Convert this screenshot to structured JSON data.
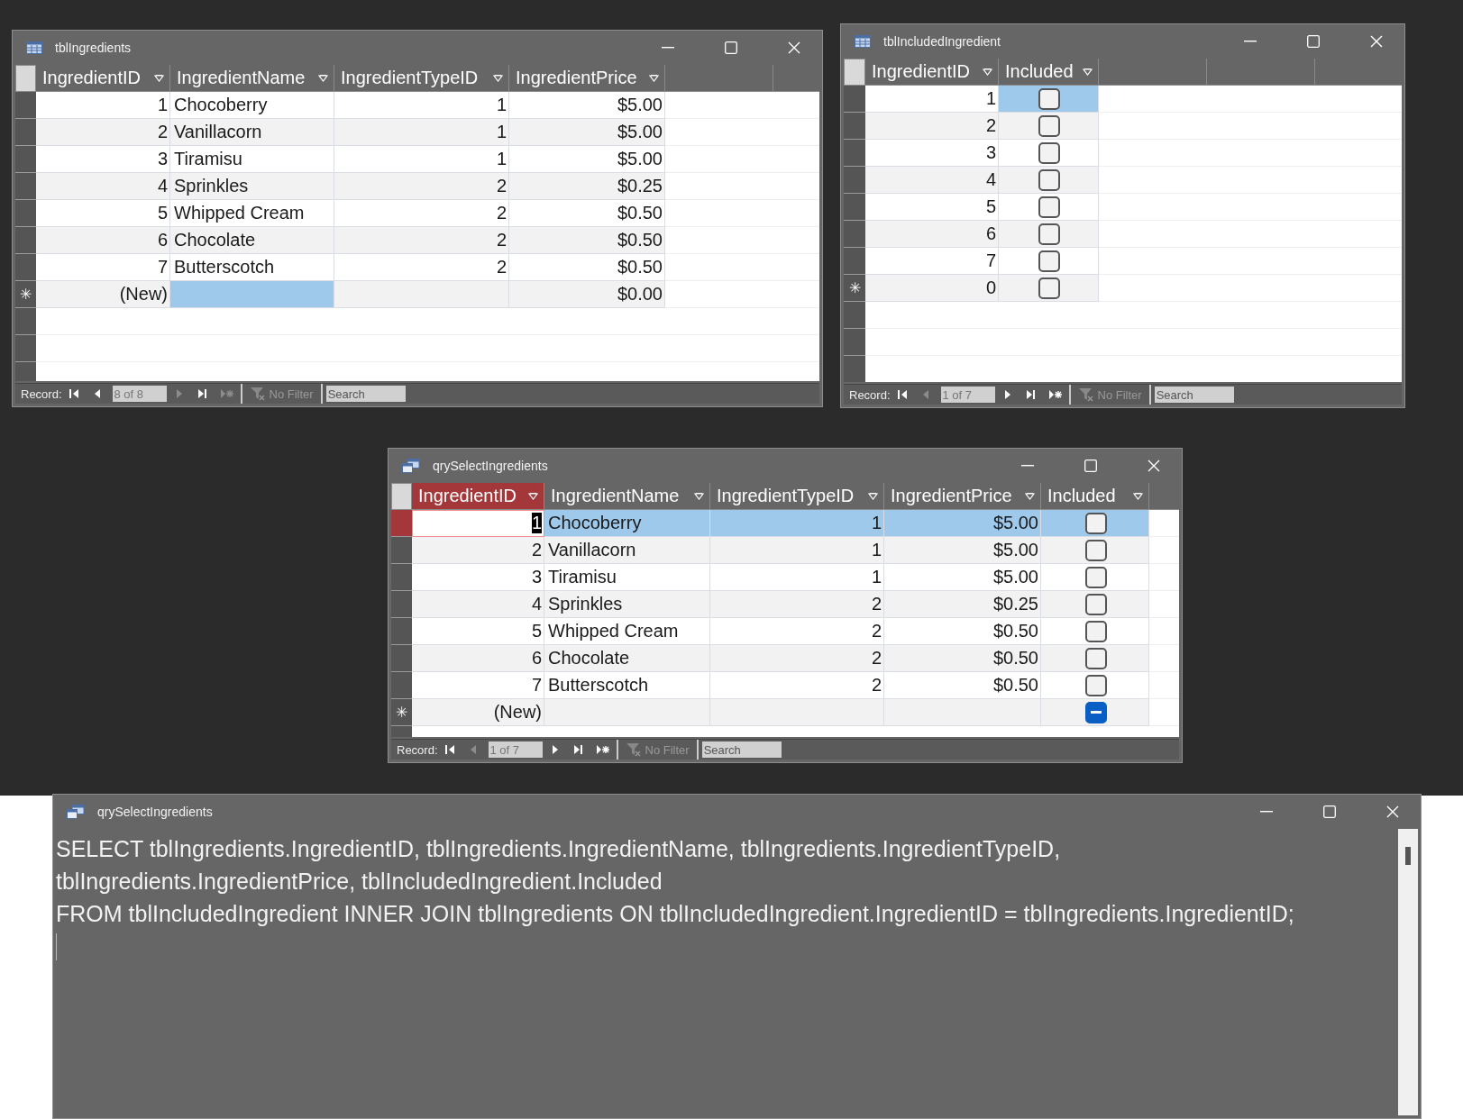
{
  "windows": [
    {
      "kind": "table",
      "title": "tblIngredients",
      "columns": [
        {
          "label": "IngredientID",
          "kind": "number",
          "focused": false
        },
        {
          "label": "IngredientName",
          "kind": "text",
          "focused": false
        },
        {
          "label": "IngredientTypeID",
          "kind": "number",
          "focused": false
        },
        {
          "label": "IngredientPrice",
          "kind": "number",
          "focused": false
        }
      ],
      "rows": [
        {
          "current": false,
          "cells": [
            {
              "text": "1",
              "selected": false
            },
            {
              "text": "Chocoberry",
              "selected": false
            },
            {
              "text": "1",
              "selected": false
            },
            {
              "text": "$5.00",
              "selected": false
            }
          ]
        },
        {
          "current": false,
          "cells": [
            {
              "text": "2",
              "selected": false
            },
            {
              "text": "Vanillacorn",
              "selected": false
            },
            {
              "text": "1",
              "selected": false
            },
            {
              "text": "$5.00",
              "selected": false
            }
          ]
        },
        {
          "current": false,
          "cells": [
            {
              "text": "3",
              "selected": false
            },
            {
              "text": "Tiramisu",
              "selected": false
            },
            {
              "text": "1",
              "selected": false
            },
            {
              "text": "$5.00",
              "selected": false
            }
          ]
        },
        {
          "current": false,
          "cells": [
            {
              "text": "4",
              "selected": false
            },
            {
              "text": "Sprinkles",
              "selected": false
            },
            {
              "text": "2",
              "selected": false
            },
            {
              "text": "$0.25",
              "selected": false
            }
          ]
        },
        {
          "current": false,
          "cells": [
            {
              "text": "5",
              "selected": false
            },
            {
              "text": "Whipped Cream",
              "selected": false
            },
            {
              "text": "2",
              "selected": false
            },
            {
              "text": "$0.50",
              "selected": false
            }
          ]
        },
        {
          "current": false,
          "cells": [
            {
              "text": "6",
              "selected": false
            },
            {
              "text": "Chocolate",
              "selected": false
            },
            {
              "text": "2",
              "selected": false
            },
            {
              "text": "$0.50",
              "selected": false
            }
          ]
        },
        {
          "current": false,
          "cells": [
            {
              "text": "7",
              "selected": false
            },
            {
              "text": "Butterscotch",
              "selected": false
            },
            {
              "text": "2",
              "selected": false
            },
            {
              "text": "$0.50",
              "selected": false
            }
          ]
        },
        {
          "current": false,
          "selector_text": "✳",
          "cells": [
            {
              "text": "(New)",
              "selected": false
            },
            {
              "selected": true
            },
            {
              "selected": false
            },
            {
              "text": "$0.00",
              "selected": false
            }
          ]
        }
      ],
      "status": {
        "label": "Record:",
        "nav": [
          {
            "kind": "first",
            "disabled": false
          },
          {
            "kind": "previous",
            "disabled": false
          },
          {
            "kind": "next",
            "disabled": true
          },
          {
            "kind": "last",
            "disabled": false
          },
          {
            "kind": "new",
            "disabled": true
          }
        ],
        "position": "8 of 8",
        "filter": "No Filter",
        "search_placeholder": "Search"
      }
    },
    {
      "kind": "table",
      "title": "tblIncludedIngredient",
      "columns": [
        {
          "label": "IngredientID",
          "kind": "number",
          "focused": false
        },
        {
          "label": "Included",
          "kind": "checkbox",
          "focused": false
        }
      ],
      "rows": [
        {
          "current": false,
          "cells": [
            {
              "text": "1",
              "selected": false
            },
            {
              "checked": false,
              "indeterminate": false,
              "selected": true
            }
          ]
        },
        {
          "current": false,
          "cells": [
            {
              "text": "2",
              "selected": false
            },
            {
              "checked": false,
              "indeterminate": false,
              "selected": false
            }
          ]
        },
        {
          "current": false,
          "cells": [
            {
              "text": "3",
              "selected": false
            },
            {
              "checked": false,
              "indeterminate": false,
              "selected": false
            }
          ]
        },
        {
          "current": false,
          "cells": [
            {
              "text": "4",
              "selected": false
            },
            {
              "checked": false,
              "indeterminate": false,
              "selected": false
            }
          ]
        },
        {
          "current": false,
          "cells": [
            {
              "text": "5",
              "selected": false
            },
            {
              "checked": false,
              "indeterminate": false,
              "selected": false
            }
          ]
        },
        {
          "current": false,
          "cells": [
            {
              "text": "6",
              "selected": false
            },
            {
              "checked": false,
              "indeterminate": false,
              "selected": false
            }
          ]
        },
        {
          "current": false,
          "cells": [
            {
              "text": "7",
              "selected": false
            },
            {
              "checked": false,
              "indeterminate": false,
              "selected": false
            }
          ]
        },
        {
          "current": false,
          "selector_text": "✳",
          "cells": [
            {
              "text": "0",
              "selected": false
            },
            {
              "checked": false,
              "indeterminate": false,
              "selected": false
            }
          ]
        }
      ],
      "status": {
        "label": "Record:",
        "nav": [
          {
            "kind": "first",
            "disabled": false
          },
          {
            "kind": "previous",
            "disabled": true
          },
          {
            "kind": "next",
            "disabled": false
          },
          {
            "kind": "last",
            "disabled": false
          },
          {
            "kind": "new",
            "disabled": false
          }
        ],
        "position": "1 of 7",
        "filter": "No Filter",
        "search_placeholder": "Search"
      }
    },
    {
      "kind": "query",
      "title": "qrySelectIngredients",
      "columns": [
        {
          "label": "IngredientID",
          "kind": "number",
          "focused": true
        },
        {
          "label": "IngredientName",
          "kind": "text",
          "focused": false
        },
        {
          "label": "IngredientTypeID",
          "kind": "number",
          "focused": false
        },
        {
          "label": "IngredientPrice",
          "kind": "number",
          "focused": false
        },
        {
          "label": "Included",
          "kind": "checkbox",
          "focused": false
        }
      ],
      "rows": [
        {
          "current": true,
          "cells": [
            {
              "text": "1",
              "selected": false
            },
            {
              "text": "Chocoberry",
              "selected": true
            },
            {
              "text": "1",
              "selected": true
            },
            {
              "text": "$5.00",
              "selected": true
            },
            {
              "checked": false,
              "indeterminate": false,
              "selected": true
            }
          ]
        },
        {
          "current": false,
          "cells": [
            {
              "text": "2",
              "selected": false
            },
            {
              "text": "Vanillacorn",
              "selected": false
            },
            {
              "text": "1",
              "selected": false
            },
            {
              "text": "$5.00",
              "selected": false
            },
            {
              "checked": false,
              "indeterminate": false,
              "selected": false
            }
          ]
        },
        {
          "current": false,
          "cells": [
            {
              "text": "3",
              "selected": false
            },
            {
              "text": "Tiramisu",
              "selected": false
            },
            {
              "text": "1",
              "selected": false
            },
            {
              "text": "$5.00",
              "selected": false
            },
            {
              "checked": false,
              "indeterminate": false,
              "selected": false
            }
          ]
        },
        {
          "current": false,
          "cells": [
            {
              "text": "4",
              "selected": false
            },
            {
              "text": "Sprinkles",
              "selected": false
            },
            {
              "text": "2",
              "selected": false
            },
            {
              "text": "$0.25",
              "selected": false
            },
            {
              "checked": false,
              "indeterminate": false,
              "selected": false
            }
          ]
        },
        {
          "current": false,
          "cells": [
            {
              "text": "5",
              "selected": false
            },
            {
              "text": "Whipped Cream",
              "selected": false
            },
            {
              "text": "2",
              "selected": false
            },
            {
              "text": "$0.50",
              "selected": false
            },
            {
              "checked": false,
              "indeterminate": false,
              "selected": false
            }
          ]
        },
        {
          "current": false,
          "cells": [
            {
              "text": "6",
              "selected": false
            },
            {
              "text": "Chocolate",
              "selected": false
            },
            {
              "text": "2",
              "selected": false
            },
            {
              "text": "$0.50",
              "selected": false
            },
            {
              "checked": false,
              "indeterminate": false,
              "selected": false
            }
          ]
        },
        {
          "current": false,
          "cells": [
            {
              "text": "7",
              "selected": false
            },
            {
              "text": "Butterscotch",
              "selected": false
            },
            {
              "text": "2",
              "selected": false
            },
            {
              "text": "$0.50",
              "selected": false
            },
            {
              "checked": false,
              "indeterminate": false,
              "selected": false
            }
          ]
        },
        {
          "current": false,
          "selector_text": "✳",
          "cells": [
            {
              "text": "(New)",
              "selected": false
            },
            {
              "selected": false
            },
            {
              "selected": false
            },
            {
              "selected": false
            },
            {
              "indeterminate": true,
              "selected": false
            }
          ]
        }
      ],
      "status": {
        "label": "Record:",
        "nav": [
          {
            "kind": "first",
            "disabled": false
          },
          {
            "kind": "previous",
            "disabled": true
          },
          {
            "kind": "next",
            "disabled": false
          },
          {
            "kind": "last",
            "disabled": false
          },
          {
            "kind": "new",
            "disabled": false
          }
        ],
        "position": "1 of 7",
        "filter": "No Filter",
        "search_placeholder": "Search"
      }
    },
    {
      "kind": "sql",
      "title": "qrySelectIngredients",
      "lines": [
        "SELECT tblIngredients.IngredientID, tblIngredients.IngredientName, tblIngredients.IngredientTypeID,",
        "tblIngredients.IngredientPrice, tblIncludedIngredient.Included",
        "FROM tblIncludedIngredient INNER JOIN tblIngredients ON tblIncludedIngredient.IngredientID = tblIngredients.IngredientID;"
      ]
    }
  ]
}
